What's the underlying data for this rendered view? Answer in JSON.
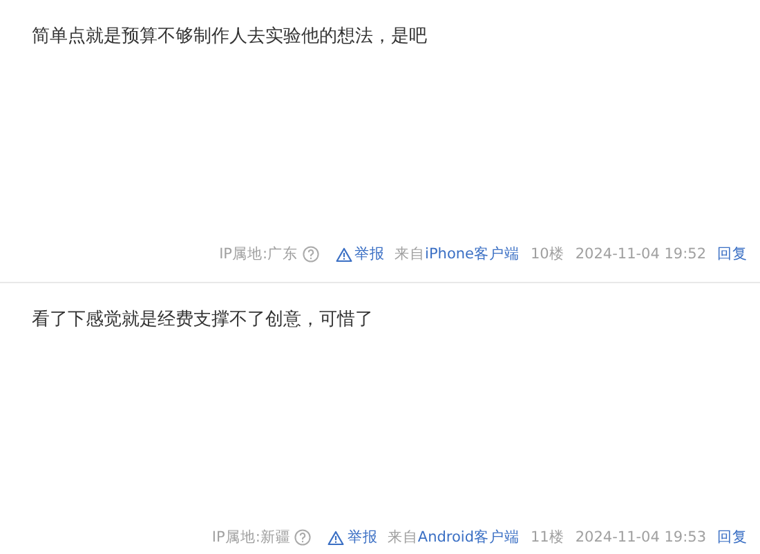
{
  "posts": [
    {
      "content": "简单点就是预算不够制作人去实验他的想法，是吧",
      "ip_location": "IP属地:广东",
      "report": "举报",
      "source_prefix": "来自",
      "source_link": "iPhone客户端",
      "floor": "10楼",
      "time": "2024-11-04 19:52",
      "reply": "回复"
    },
    {
      "content": "看了下感觉就是经费支撑不了创意，可惜了",
      "ip_location": "IP属地:新疆",
      "report": "举报",
      "source_prefix": "来自",
      "source_link": "Android客户端",
      "floor": "11楼",
      "time": "2024-11-04 19:53",
      "reply": "回复"
    }
  ]
}
